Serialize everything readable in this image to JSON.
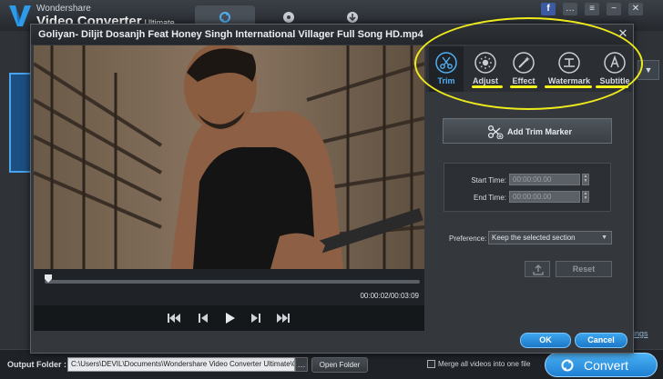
{
  "app": {
    "brand_small": "Wondershare",
    "brand_big": "Video Converter",
    "brand_edition": "Ultimate",
    "top_tabs": [
      {
        "icon": "convert-icon",
        "active": true
      },
      {
        "icon": "burn-disc-icon",
        "active": false
      },
      {
        "icon": "download-icon",
        "active": false
      }
    ],
    "window_buttons": [
      "f",
      "…",
      "≡",
      "−",
      "✕"
    ],
    "settings_link": "ttings",
    "dropdown_glyph": "▼"
  },
  "bottom": {
    "output_label": "Output Folder :",
    "output_path": "C:\\Users\\DEVIL\\Documents\\Wondershare Video Converter Ultimate\\Outp",
    "browse_label": "…",
    "open_folder": "Open Folder",
    "merge_label": "Merge all videos into one file",
    "convert": "Convert"
  },
  "dialog": {
    "title": "Goliyan- Diljit Dosanjh Feat Honey Singh International Villager Full Song HD.mp4",
    "close": "✕",
    "tabs": [
      {
        "label": "Trim",
        "icon": "scissors-icon",
        "active": true
      },
      {
        "label": "Adjust",
        "icon": "adjust-icon",
        "active": false
      },
      {
        "label": "Effect",
        "icon": "magic-wand-icon",
        "active": false
      },
      {
        "label": "Watermark",
        "icon": "watermark-icon",
        "active": false
      },
      {
        "label": "Subtitle",
        "icon": "subtitle-icon",
        "active": false
      }
    ],
    "annotation_color": "#f7f31a",
    "accent_color": "#2f8fe0",
    "playback": {
      "time": "00:00:02/00:03:09",
      "progress": 0.01
    },
    "trim": {
      "add_marker": "Add Trim Marker",
      "start_label": "Start Time:",
      "start_value": "00:00:00.00",
      "end_label": "End Time:",
      "end_value": "00:00:00.00",
      "preference_label": "Preference:",
      "preference_value": "Keep the selected section",
      "reset": "Reset"
    },
    "ok": "OK",
    "cancel": "Cancel"
  }
}
